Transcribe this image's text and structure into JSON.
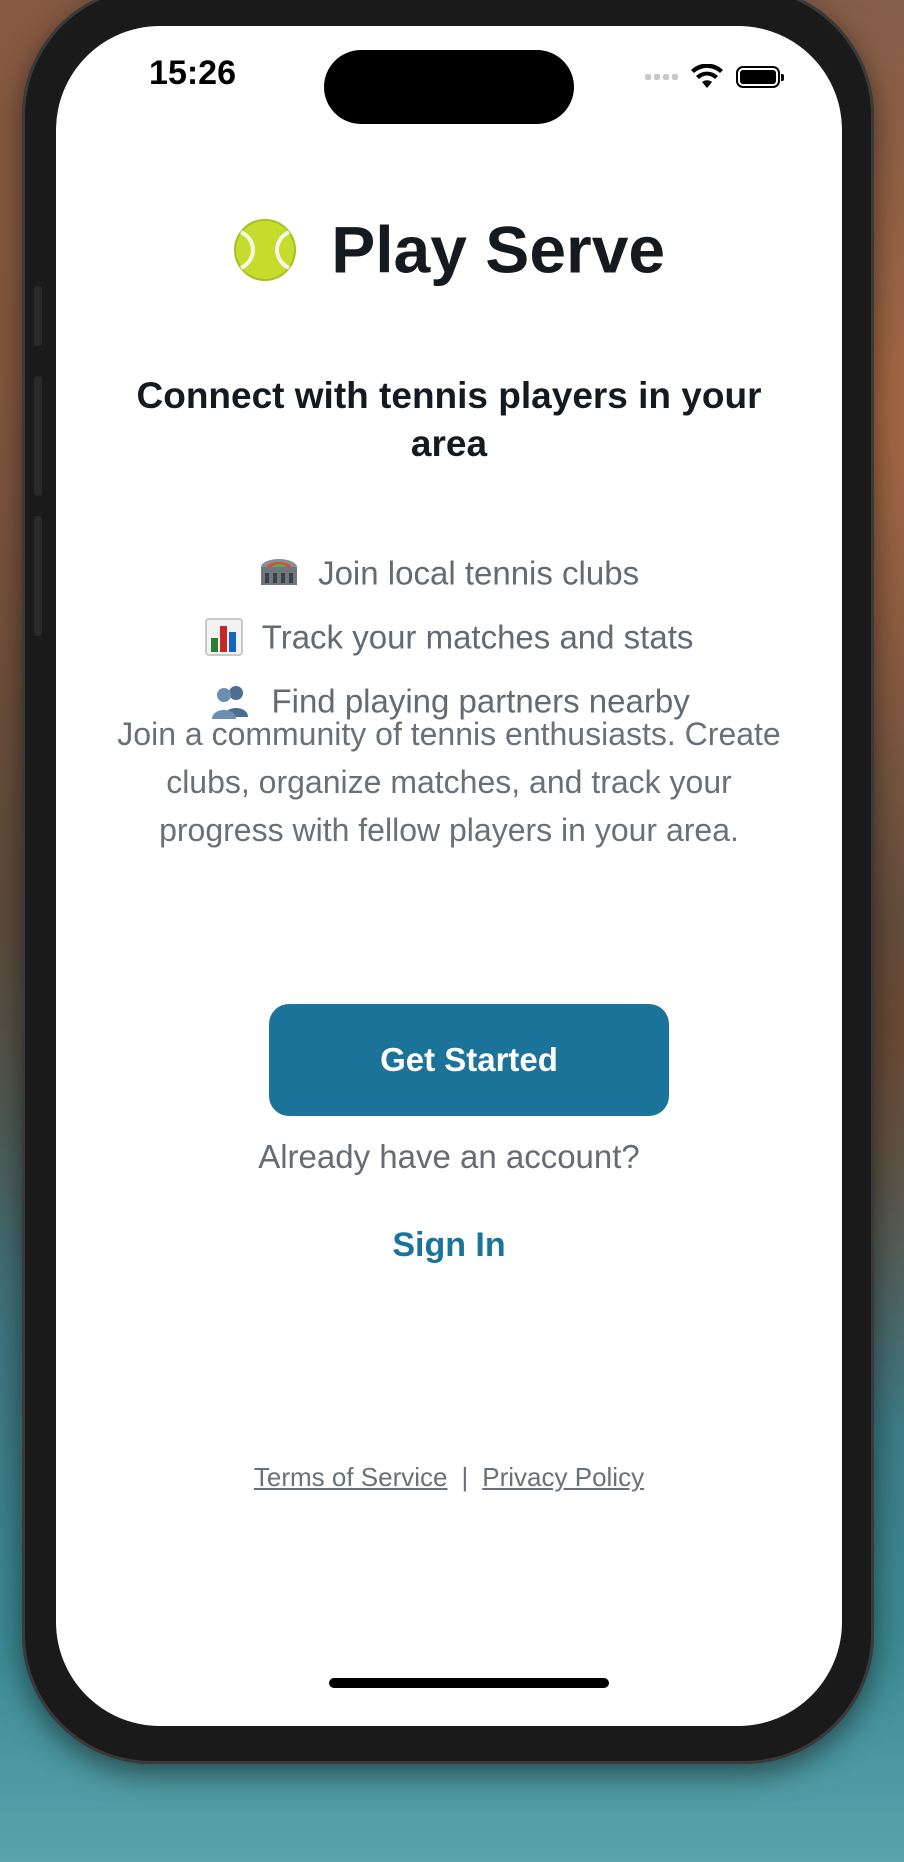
{
  "status_bar": {
    "time": "15:26",
    "icons": [
      "cellular-signal-icon",
      "wifi-icon",
      "battery-icon"
    ]
  },
  "app": {
    "title_icon": "tennis-ball-icon",
    "title": "Play Serve"
  },
  "headline": "Connect with tennis players in your area",
  "features": [
    {
      "icon": "stadium-icon",
      "text": "Join local tennis clubs"
    },
    {
      "icon": "bar-chart-icon",
      "text": "Track your matches and stats"
    },
    {
      "icon": "people-icon",
      "text": "Find playing partners nearby"
    }
  ],
  "description": "Join a community of tennis enthusiasts. Create clubs, organize matches, and track your progress with fellow players in your area.",
  "actions": {
    "get_started": "Get Started",
    "already_have_account": "Already have an account?",
    "sign_in": "Sign In"
  },
  "footer": {
    "terms": "Terms of Service",
    "separator": "|",
    "privacy": "Privacy Policy"
  },
  "colors": {
    "primary": "#1b7399",
    "heading": "#151a20",
    "muted": "#636a72",
    "background": "#ffffff"
  }
}
